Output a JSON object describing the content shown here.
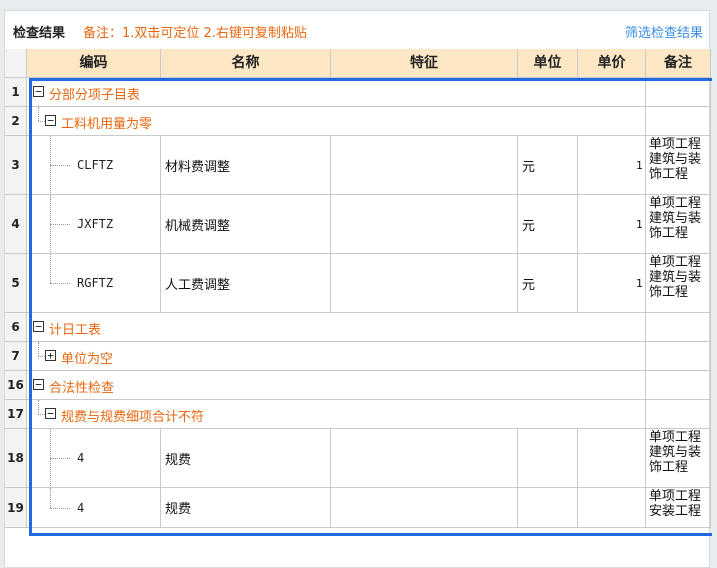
{
  "header": {
    "title": "检查结果",
    "note": "备注：1.双击可定位 2.右键可复制粘贴",
    "filter_link": "筛选检查结果"
  },
  "columns": [
    "编码",
    "名称",
    "特征",
    "单位",
    "单价",
    "备注"
  ],
  "rows": [
    {
      "no": "1",
      "label": "分部分项子目表",
      "exp": "−"
    },
    {
      "no": "2",
      "label": "工料机用量为零",
      "exp": "−"
    },
    {
      "no": "3",
      "code": "CLFTZ",
      "name": "材料费调整",
      "unit": "元",
      "price": "1",
      "note": "单项工程建筑与装饰工程"
    },
    {
      "no": "4",
      "code": "JXFTZ",
      "name": "机械费调整",
      "unit": "元",
      "price": "1",
      "note": "单项工程建筑与装饰工程"
    },
    {
      "no": "5",
      "code": "RGFTZ",
      "name": "人工费调整",
      "unit": "元",
      "price": "1",
      "note": "单项工程建筑与装饰工程"
    },
    {
      "no": "6",
      "label": "计日工表",
      "exp": "−"
    },
    {
      "no": "7",
      "label": "单位为空",
      "exp": "+"
    },
    {
      "no": "16",
      "label": "合法性检查",
      "exp": "−"
    },
    {
      "no": "17",
      "label": "规费与规费细项合计不符",
      "exp": "−"
    },
    {
      "no": "18",
      "code": "4",
      "name": "规费",
      "note": "单项工程建筑与装饰工程"
    },
    {
      "no": "19",
      "code": "4",
      "name": "规费",
      "note": "单项工程安装工程"
    }
  ]
}
